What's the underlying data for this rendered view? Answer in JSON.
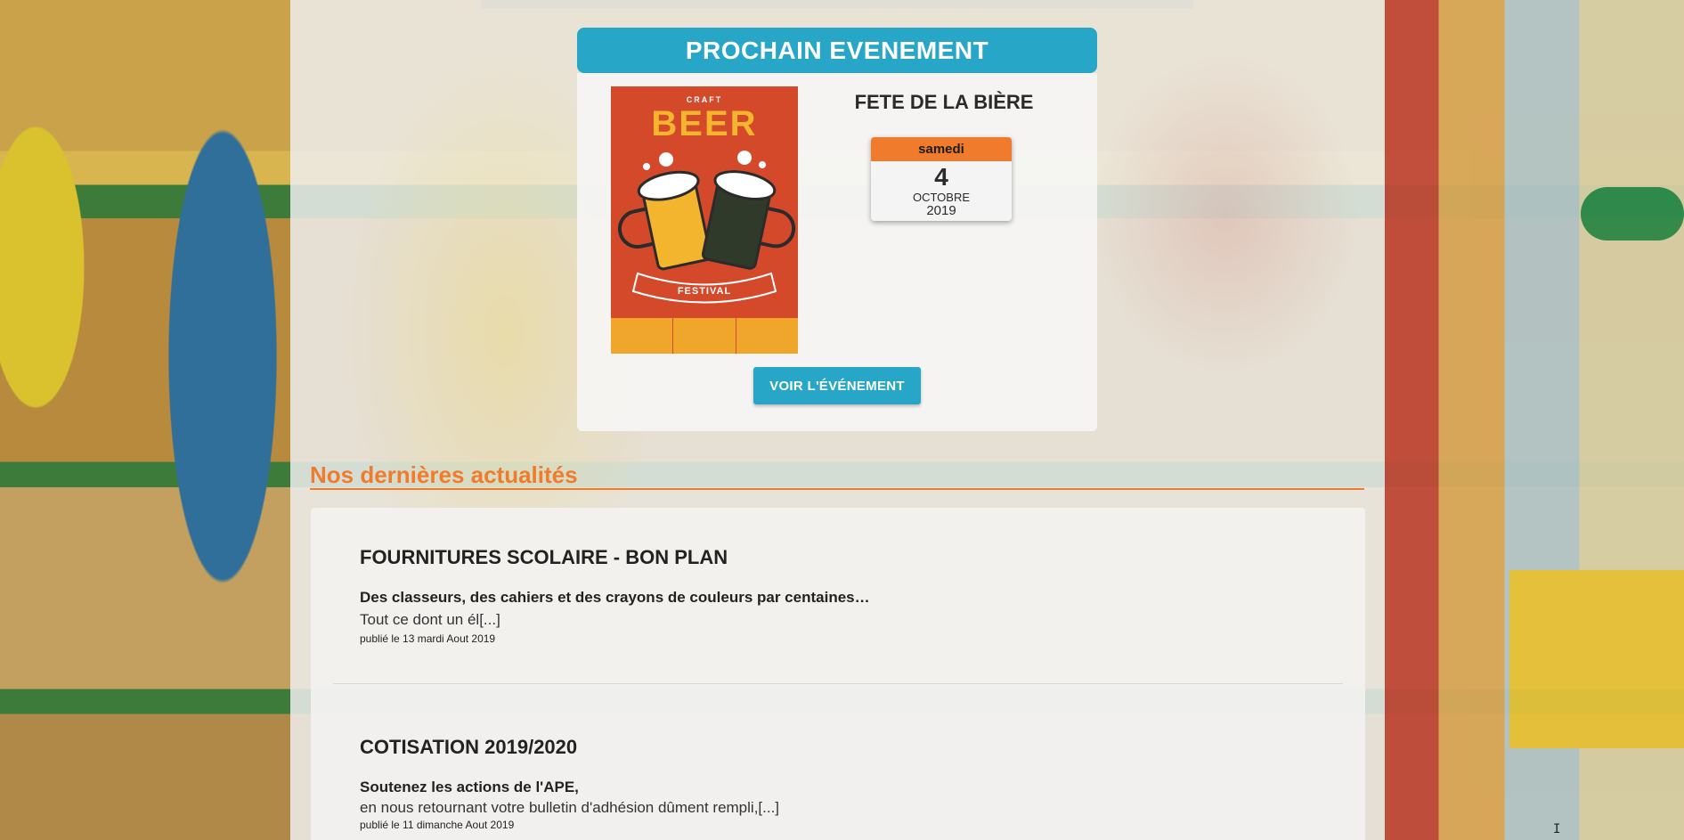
{
  "event": {
    "header": "PROCHAIN EVENEMENT",
    "title": "FETE DE LA BIÈRE",
    "date": {
      "weekday": "samedi",
      "day": "4",
      "month": "OCTOBRE",
      "year": "2019"
    },
    "poster": {
      "top_text": "CRAFT",
      "main_text": "BEER",
      "banner_text": "FESTIVAL"
    },
    "button_label": "VOIR L'ÉVÉNEMENT"
  },
  "news": {
    "heading": "Nos dernières actualités",
    "articles": [
      {
        "title": "FOURNITURES SCOLAIRE - BON PLAN",
        "lead": "Des classeurs, des cahiers et des crayons de couleurs par centaines…",
        "body": "Tout ce dont un él[...]",
        "meta": "publié le 13 mardi Aout 2019"
      },
      {
        "title": "COTISATION 2019/2020",
        "lead": "Soutenez les actions de l'APE,",
        "body": "en nous retournant votre bulletin d'adhésion dûment rempli,[...]",
        "meta": "publié le 11 dimanche Aout 2019"
      }
    ]
  },
  "colors": {
    "accent_blue": "#27a6c8",
    "accent_orange": "#f07b2d"
  },
  "icons": {
    "cursor": "text-cursor-icon"
  }
}
